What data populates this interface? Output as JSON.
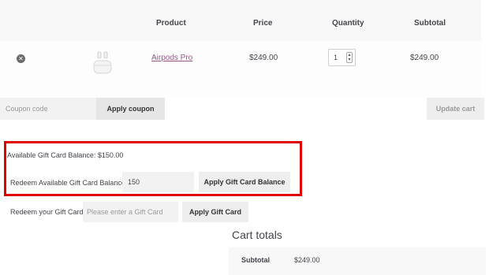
{
  "table": {
    "headers": {
      "product": "Product",
      "price": "Price",
      "quantity": "Quantity",
      "subtotal": "Subtotal"
    },
    "item": {
      "name": "Airpods Pro",
      "price": "$249.00",
      "quantity": "1",
      "subtotal": "$249.00",
      "remove_icon": "remove-circle-x"
    }
  },
  "coupon": {
    "placeholder": "Coupon code",
    "apply_label": "Apply coupon",
    "update_label": "Update cart"
  },
  "gift": {
    "balance_text": "Available Gift Card Balance: $150.00",
    "redeem_balance_label": "Redeem Available Gift Card Balance",
    "redeem_balance_value": "150",
    "apply_balance_label": "Apply Gift Card Balance",
    "redeem_card_label": "Redeem your Gift Card",
    "card_placeholder": "Please enter a Gift Card",
    "apply_card_label": "Apply Gift Card"
  },
  "totals": {
    "title": "Cart totals",
    "subtotal_label": "Subtotal",
    "subtotal_value": "$249.00"
  },
  "colors": {
    "highlight": "#e00000",
    "link": "#96588a"
  }
}
